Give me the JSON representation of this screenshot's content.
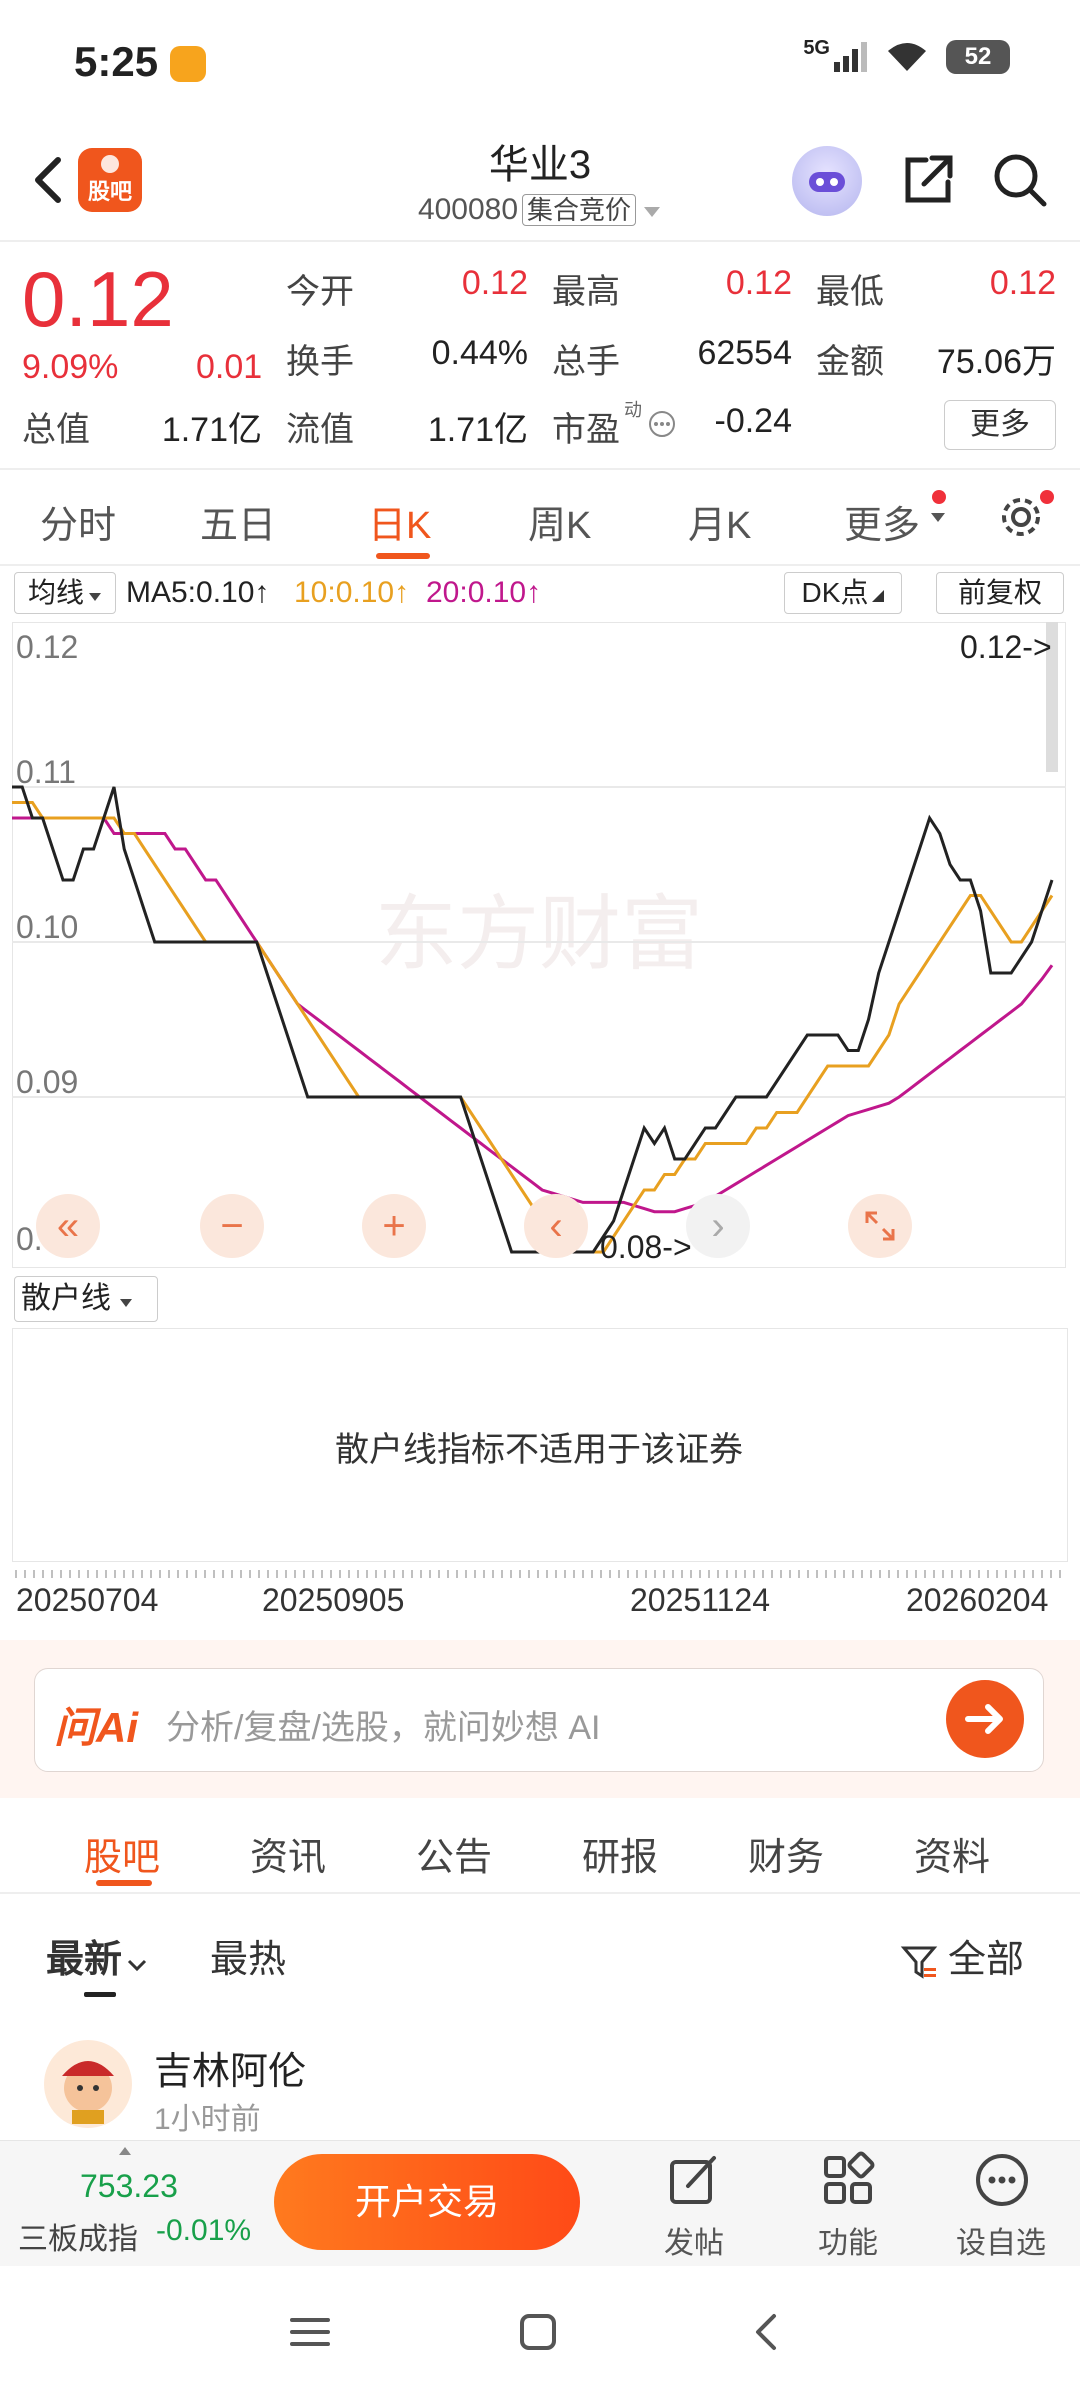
{
  "status_bar": {
    "time": "5:25",
    "network": "5G",
    "battery": "52"
  },
  "header": {
    "app_logo": "股吧",
    "stock_name": "华业3",
    "stock_code": "400080",
    "auction_tag": "集合竞价"
  },
  "quote": {
    "price": "0.12",
    "change_pct": "9.09%",
    "change": "0.01",
    "fields": [
      {
        "label": "今开",
        "value": "0.12",
        "color": "#e8303a"
      },
      {
        "label": "最高",
        "value": "0.12",
        "color": "#e8303a"
      },
      {
        "label": "最低",
        "value": "0.12",
        "color": "#e8303a"
      },
      {
        "label": "换手",
        "value": "0.44%",
        "color": "#222222"
      },
      {
        "label": "总手",
        "value": "62554",
        "color": "#222222"
      },
      {
        "label": "金额",
        "value": "75.06万",
        "color": "#222222"
      },
      {
        "label": "总值",
        "value": "1.71亿",
        "color": "#222222"
      },
      {
        "label": "流值",
        "value": "1.71亿",
        "color": "#222222"
      },
      {
        "label": "市盈",
        "value": "-0.24",
        "color": "#222222"
      }
    ],
    "pe_badge": "动",
    "more_label": "更多"
  },
  "kline_tabs": [
    "分时",
    "五日",
    "日K",
    "周K",
    "月K",
    "更多"
  ],
  "active_kline_tab": "日K",
  "ma_bar": {
    "select_label": "均线",
    "ma5": "MA5:0.10",
    "ma10": "10:0.10",
    "ma20": "20:0.10",
    "dk_label": "DK点",
    "adjust_label": "前复权",
    "ma5_color": "#222222",
    "ma10_color": "#e8a020",
    "ma20_color": "#c0178c"
  },
  "chart_data": {
    "type": "line",
    "watermark": "东方财富",
    "ylim": [
      0.08,
      0.12
    ],
    "y_ticks": [
      "0.12",
      "0.11",
      "0.10",
      "0.09",
      "0.08"
    ],
    "max_marker": "0.12->",
    "min_marker": "0.08->",
    "x_labels": [
      "20250704",
      "20250905",
      "20251124",
      "20260204"
    ],
    "series": [
      {
        "name": "MA5",
        "color": "#222222",
        "values": [
          0.11,
          0.11,
          0.108,
          0.108,
          0.106,
          0.104,
          0.104,
          0.106,
          0.106,
          0.108,
          0.11,
          0.106,
          0.104,
          0.102,
          0.1,
          0.1,
          0.1,
          0.1,
          0.1,
          0.1,
          0.1,
          0.1,
          0.1,
          0.1,
          0.1,
          0.098,
          0.096,
          0.094,
          0.092,
          0.09,
          0.09,
          0.09,
          0.09,
          0.09,
          0.09,
          0.09,
          0.09,
          0.09,
          0.09,
          0.09,
          0.09,
          0.09,
          0.09,
          0.09,
          0.09,
          0.088,
          0.086,
          0.084,
          0.082,
          0.08,
          0.08,
          0.08,
          0.08,
          0.08,
          0.08,
          0.08,
          0.08,
          0.08,
          0.081,
          0.082,
          0.084,
          0.086,
          0.088,
          0.087,
          0.088,
          0.086,
          0.086,
          0.087,
          0.088,
          0.088,
          0.089,
          0.09,
          0.09,
          0.09,
          0.09,
          0.091,
          0.092,
          0.093,
          0.094,
          0.094,
          0.094,
          0.094,
          0.093,
          0.093,
          0.095,
          0.098,
          0.1,
          0.102,
          0.104,
          0.106,
          0.108,
          0.107,
          0.105,
          0.104,
          0.104,
          0.102,
          0.098,
          0.098,
          0.098,
          0.099,
          0.1,
          0.102,
          0.104
        ]
      },
      {
        "name": "MA10",
        "color": "#e8a020",
        "values": [
          0.109,
          0.109,
          0.109,
          0.108,
          0.108,
          0.108,
          0.108,
          0.108,
          0.108,
          0.108,
          0.108,
          0.107,
          0.107,
          0.106,
          0.105,
          0.104,
          0.103,
          0.102,
          0.101,
          0.1,
          0.1,
          0.1,
          0.1,
          0.1,
          0.1,
          0.099,
          0.098,
          0.097,
          0.096,
          0.095,
          0.094,
          0.093,
          0.092,
          0.091,
          0.09,
          0.09,
          0.09,
          0.09,
          0.09,
          0.09,
          0.09,
          0.09,
          0.09,
          0.09,
          0.09,
          0.089,
          0.088,
          0.087,
          0.086,
          0.085,
          0.084,
          0.083,
          0.082,
          0.081,
          0.081,
          0.08,
          0.08,
          0.08,
          0.08,
          0.081,
          0.082,
          0.083,
          0.084,
          0.084,
          0.085,
          0.085,
          0.086,
          0.086,
          0.087,
          0.087,
          0.087,
          0.087,
          0.087,
          0.088,
          0.088,
          0.089,
          0.089,
          0.089,
          0.09,
          0.091,
          0.092,
          0.092,
          0.092,
          0.092,
          0.092,
          0.093,
          0.094,
          0.096,
          0.097,
          0.098,
          0.099,
          0.1,
          0.101,
          0.102,
          0.103,
          0.103,
          0.102,
          0.101,
          0.1,
          0.1,
          0.101,
          0.102,
          0.103
        ]
      },
      {
        "name": "MA20",
        "color": "#c0178c",
        "values": [
          0.108,
          0.108,
          0.108,
          0.108,
          0.108,
          0.108,
          0.108,
          0.108,
          0.108,
          0.108,
          0.107,
          0.107,
          0.107,
          0.107,
          0.107,
          0.107,
          0.106,
          0.106,
          0.105,
          0.104,
          0.104,
          0.103,
          0.102,
          0.101,
          0.1,
          0.099,
          0.098,
          0.097,
          0.096,
          0.0955,
          0.095,
          0.0945,
          0.094,
          0.0935,
          0.093,
          0.0925,
          0.092,
          0.0915,
          0.091,
          0.0905,
          0.09,
          0.0895,
          0.089,
          0.0885,
          0.088,
          0.0875,
          0.087,
          0.0865,
          0.086,
          0.0855,
          0.085,
          0.0845,
          0.084,
          0.0838,
          0.0836,
          0.0834,
          0.0832,
          0.0832,
          0.0832,
          0.0832,
          0.0832,
          0.083,
          0.0828,
          0.0826,
          0.0826,
          0.0826,
          0.0828,
          0.083,
          0.0833,
          0.0836,
          0.084,
          0.0844,
          0.0848,
          0.0852,
          0.0856,
          0.086,
          0.0864,
          0.0868,
          0.0872,
          0.0876,
          0.088,
          0.0884,
          0.0888,
          0.089,
          0.0892,
          0.0894,
          0.0896,
          0.09,
          0.0905,
          0.091,
          0.0915,
          0.092,
          0.0925,
          0.093,
          0.0935,
          0.094,
          0.0945,
          0.095,
          0.0955,
          0.096,
          0.0968,
          0.0976,
          0.0985
        ]
      }
    ]
  },
  "indicator": {
    "select_label": "散户线",
    "message": "散户线指标不适用于该证券"
  },
  "ai_search": {
    "logo": "问Ai",
    "placeholder": "分析/复盘/选股，就问妙想 AI"
  },
  "content_tabs": [
    "股吧",
    "资讯",
    "公告",
    "研报",
    "财务",
    "资料"
  ],
  "active_content_tab": "股吧",
  "sort": {
    "latest": "最新",
    "hottest": "最热",
    "filter": "全部"
  },
  "post": {
    "author": "吉林阿伦",
    "time": "1小时前"
  },
  "bottom_bar": {
    "index_value": "753.23",
    "index_name": "三板成指",
    "index_change": "-0.01%",
    "trade_label": "开户交易",
    "items": [
      "发帖",
      "功能",
      "设自选"
    ]
  }
}
